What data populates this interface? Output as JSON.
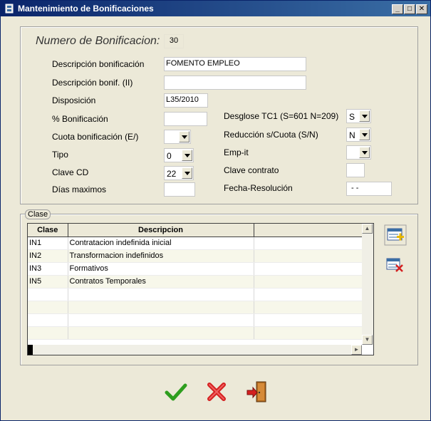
{
  "window": {
    "title": "Mantenimiento de Bonificaciones",
    "min": "_",
    "max": "□",
    "close": "✕"
  },
  "header": {
    "label": "Numero de Bonificacion:",
    "value": "30"
  },
  "form": {
    "descripcion_label": "Descripción  bonificación",
    "descripcion_value": "FOMENTO EMPLEO",
    "descripcion2_label": "Descripción bonif. (II)",
    "descripcion2_value": "",
    "disposicion_label": "Disposición",
    "disposicion_value": "L35/2010",
    "pct_label": "% Bonificación",
    "pct_value": "",
    "cuota_label": "Cuota bonificación (E/)",
    "cuota_value": "",
    "tipo_label": "Tipo",
    "tipo_value": "0",
    "clavecd_label": "Clave CD",
    "clavecd_value": "22",
    "dias_label": "Días maximos",
    "dias_value": "",
    "desglose_label": "Desglose  TC1 (S=601 N=209)",
    "desglose_value": "S",
    "reduccion_label": "Reducción s/Cuota (S/N)",
    "reduccion_value": "N",
    "empit_label": "Emp-it",
    "empit_value": "",
    "clavecontrato_label": "Clave contrato",
    "clavecontrato_value": "",
    "fecha_label": "Fecha-Resolución",
    "fecha_value": "- -"
  },
  "clase": {
    "legend": "Clase",
    "columns": [
      "Clase",
      "Descripcion"
    ],
    "rows": [
      {
        "clase": "IN1",
        "desc": "Contratacion indefinida inicial"
      },
      {
        "clase": "IN2",
        "desc": "Transformacion indefinidos"
      },
      {
        "clase": "IN3",
        "desc": "Formativos"
      },
      {
        "clase": "IN5",
        "desc": "Contratos Temporales"
      },
      {
        "clase": "",
        "desc": ""
      },
      {
        "clase": "",
        "desc": ""
      },
      {
        "clase": "",
        "desc": ""
      },
      {
        "clase": "",
        "desc": ""
      }
    ]
  },
  "icons": {
    "add_row": "add-row-icon",
    "delete_row": "delete-row-icon",
    "accept": "checkmark-icon",
    "cancel": "cross-icon",
    "exit": "exit-door-icon"
  },
  "colors": {
    "titlebar": "#0a246a",
    "accept": "#2e9e1e",
    "cancel": "#d42020"
  }
}
